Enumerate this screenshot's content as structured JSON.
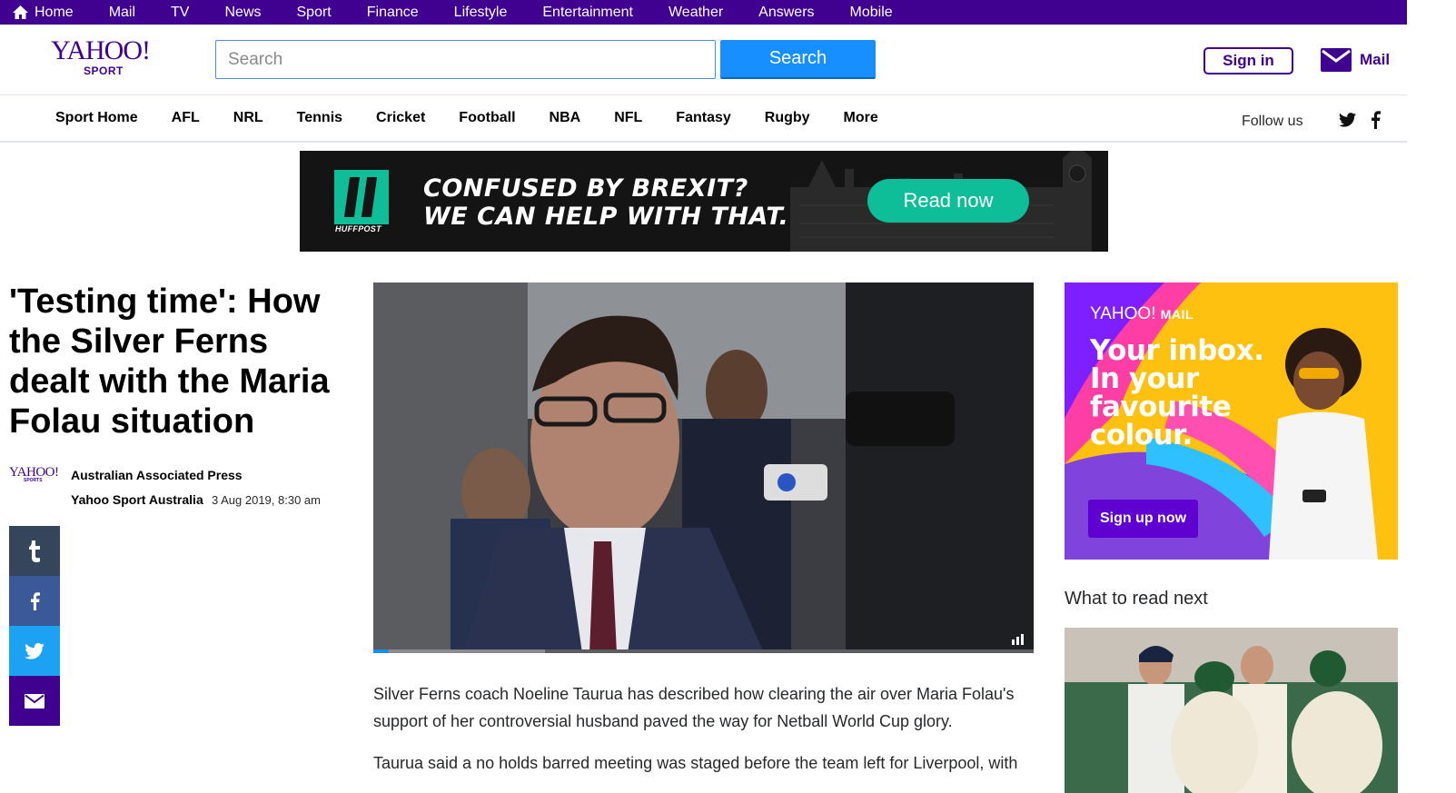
{
  "topnav": {
    "items": [
      "Home",
      "Mail",
      "TV",
      "News",
      "Sport",
      "Finance",
      "Lifestyle",
      "Entertainment",
      "Weather",
      "Answers",
      "Mobile"
    ]
  },
  "header": {
    "logo_main": "YAHOO!",
    "logo_sub": "SPORT",
    "search_placeholder": "Search",
    "search_value": "",
    "search_button": "Search",
    "signin": "Sign in",
    "mail": "Mail"
  },
  "sportnav": {
    "items": [
      "Sport Home",
      "AFL",
      "NRL",
      "Tennis",
      "Cricket",
      "Football",
      "NBA",
      "NFL",
      "Fantasy",
      "Rugby",
      "More"
    ],
    "follow_label": "Follow us"
  },
  "banner_ad": {
    "brand": "HUFFPOST",
    "line1": "CONFUSED BY BREXIT?",
    "line2": "WE CAN HELP WITH THAT.",
    "cta": "Read now"
  },
  "article": {
    "headline": "'Testing time': How the Silver Ferns dealt with the Maria Folau situation",
    "author_logo_main": "YAHOO!",
    "author_logo_sub": "SPORTS",
    "source": "Australian Associated Press",
    "publisher": "Yahoo Sport Australia",
    "date": "3 Aug 2019, 8:30 am",
    "paragraphs": [
      "Silver Ferns coach Noeline Taurua has described how clearing the air over Maria Folau's support of her controversial husband paved the way for Netball World Cup glory.",
      "Taurua said a no holds barred meeting was staged before the team left for Liverpool, with"
    ],
    "video_progress_fraction": 0.023,
    "video_buffered_fraction": 0.26
  },
  "mail_ad": {
    "brand": "YAHOO!",
    "brand_suffix": "MAIL",
    "line1": "Your inbox.",
    "line2": "In your",
    "line3": "favourite",
    "line4": "colour.",
    "cta": "Sign up now"
  },
  "sidebar": {
    "what_to_read": "What to read next"
  },
  "colors": {
    "brand_purple": "#400090",
    "search_blue": "#188fff",
    "huffpost_green": "#0dbe98",
    "mail_ad_yellow": "#ffc110"
  }
}
